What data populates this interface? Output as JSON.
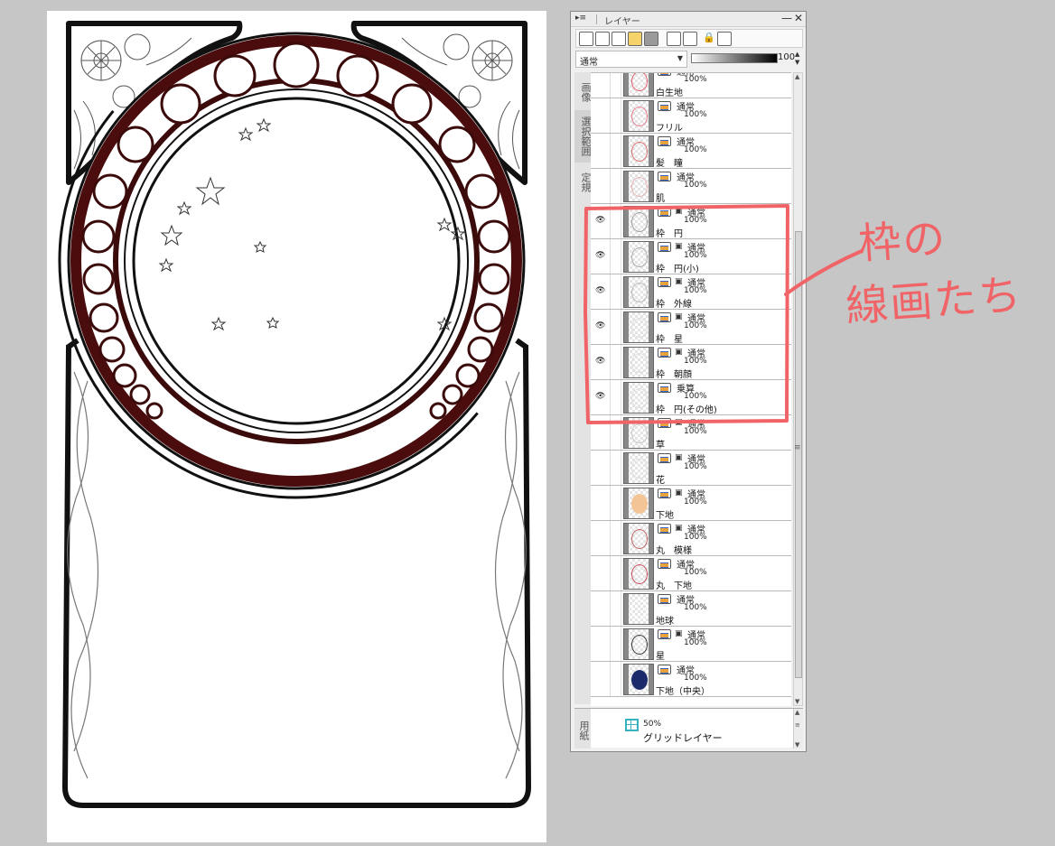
{
  "panel": {
    "tab_label": "レイヤー",
    "grip_glyph": "▸≡",
    "minimize_glyph": "—",
    "close_glyph": "✕"
  },
  "blend_mode": {
    "value": "通常",
    "opacity_value": "100"
  },
  "side_tabs": [
    "画像",
    "選択範囲",
    "定規"
  ],
  "layers": [
    {
      "name": "白生地",
      "blend": "通常",
      "opacity": "100%",
      "visible": false,
      "mask": false,
      "thumb_color": "#e05a6a"
    },
    {
      "name": "フリル",
      "blend": "通常",
      "opacity": "100%",
      "visible": false,
      "mask": false,
      "thumb_color": "#e77a8a"
    },
    {
      "name": "髪　瞳",
      "blend": "通常",
      "opacity": "100%",
      "visible": false,
      "mask": false,
      "thumb_color": "#d96a6a"
    },
    {
      "name": "肌",
      "blend": "通常",
      "opacity": "100%",
      "visible": false,
      "mask": false,
      "thumb_color": "#e8b0b0"
    },
    {
      "name": "枠　円",
      "blend": "通常",
      "opacity": "100%",
      "visible": true,
      "mask": true,
      "thumb_color": "#9a9a9a"
    },
    {
      "name": "枠　円(小)",
      "blend": "通常",
      "opacity": "100%",
      "visible": true,
      "mask": true,
      "thumb_color": "#aaaaaa"
    },
    {
      "name": "枠　外線",
      "blend": "通常",
      "opacity": "100%",
      "visible": true,
      "mask": true,
      "thumb_color": "#b5b5b5"
    },
    {
      "name": "枠　星",
      "blend": "通常",
      "opacity": "100%",
      "visible": true,
      "mask": true,
      "thumb_color": "#dddddd"
    },
    {
      "name": "枠　朝顔",
      "blend": "通常",
      "opacity": "100%",
      "visible": true,
      "mask": true,
      "thumb_color": "#dddddd"
    },
    {
      "name": "枠　円(その他)",
      "blend": "乗算",
      "opacity": "100%",
      "visible": true,
      "mask": false,
      "thumb_color": "#dddddd"
    },
    {
      "name": "草",
      "blend": "通常",
      "opacity": "100%",
      "visible": false,
      "mask": true,
      "thumb_color": "#c8c8c8"
    },
    {
      "name": "花",
      "blend": "通常",
      "opacity": "100%",
      "visible": false,
      "mask": true,
      "thumb_color": "#dddddd"
    },
    {
      "name": "下地",
      "blend": "通常",
      "opacity": "100%",
      "visible": false,
      "mask": true,
      "thumb_color": "#f3c596"
    },
    {
      "name": "丸　模様",
      "blend": "通常",
      "opacity": "100%",
      "visible": false,
      "mask": true,
      "thumb_color": "#c06060"
    },
    {
      "name": "丸　下地",
      "blend": "通常",
      "opacity": "100%",
      "visible": false,
      "mask": false,
      "thumb_color": "#c84a5a"
    },
    {
      "name": "地球",
      "blend": "通常",
      "opacity": "100%",
      "visible": false,
      "mask": false,
      "thumb_color": "#ffffff"
    },
    {
      "name": "星",
      "blend": "通常",
      "opacity": "100%",
      "visible": false,
      "mask": true,
      "thumb_color": "#333333"
    },
    {
      "name": "下地（中央）",
      "blend": "通常",
      "opacity": "100%",
      "visible": false,
      "mask": false,
      "thumb_color": "#1b2a6b"
    }
  ],
  "paper": {
    "side_label": "用紙",
    "opacity": "50%",
    "name": "グリッドレイヤー"
  },
  "annotation": {
    "line1": "枠の",
    "line2": "線画たち",
    "color": "#f06468"
  }
}
